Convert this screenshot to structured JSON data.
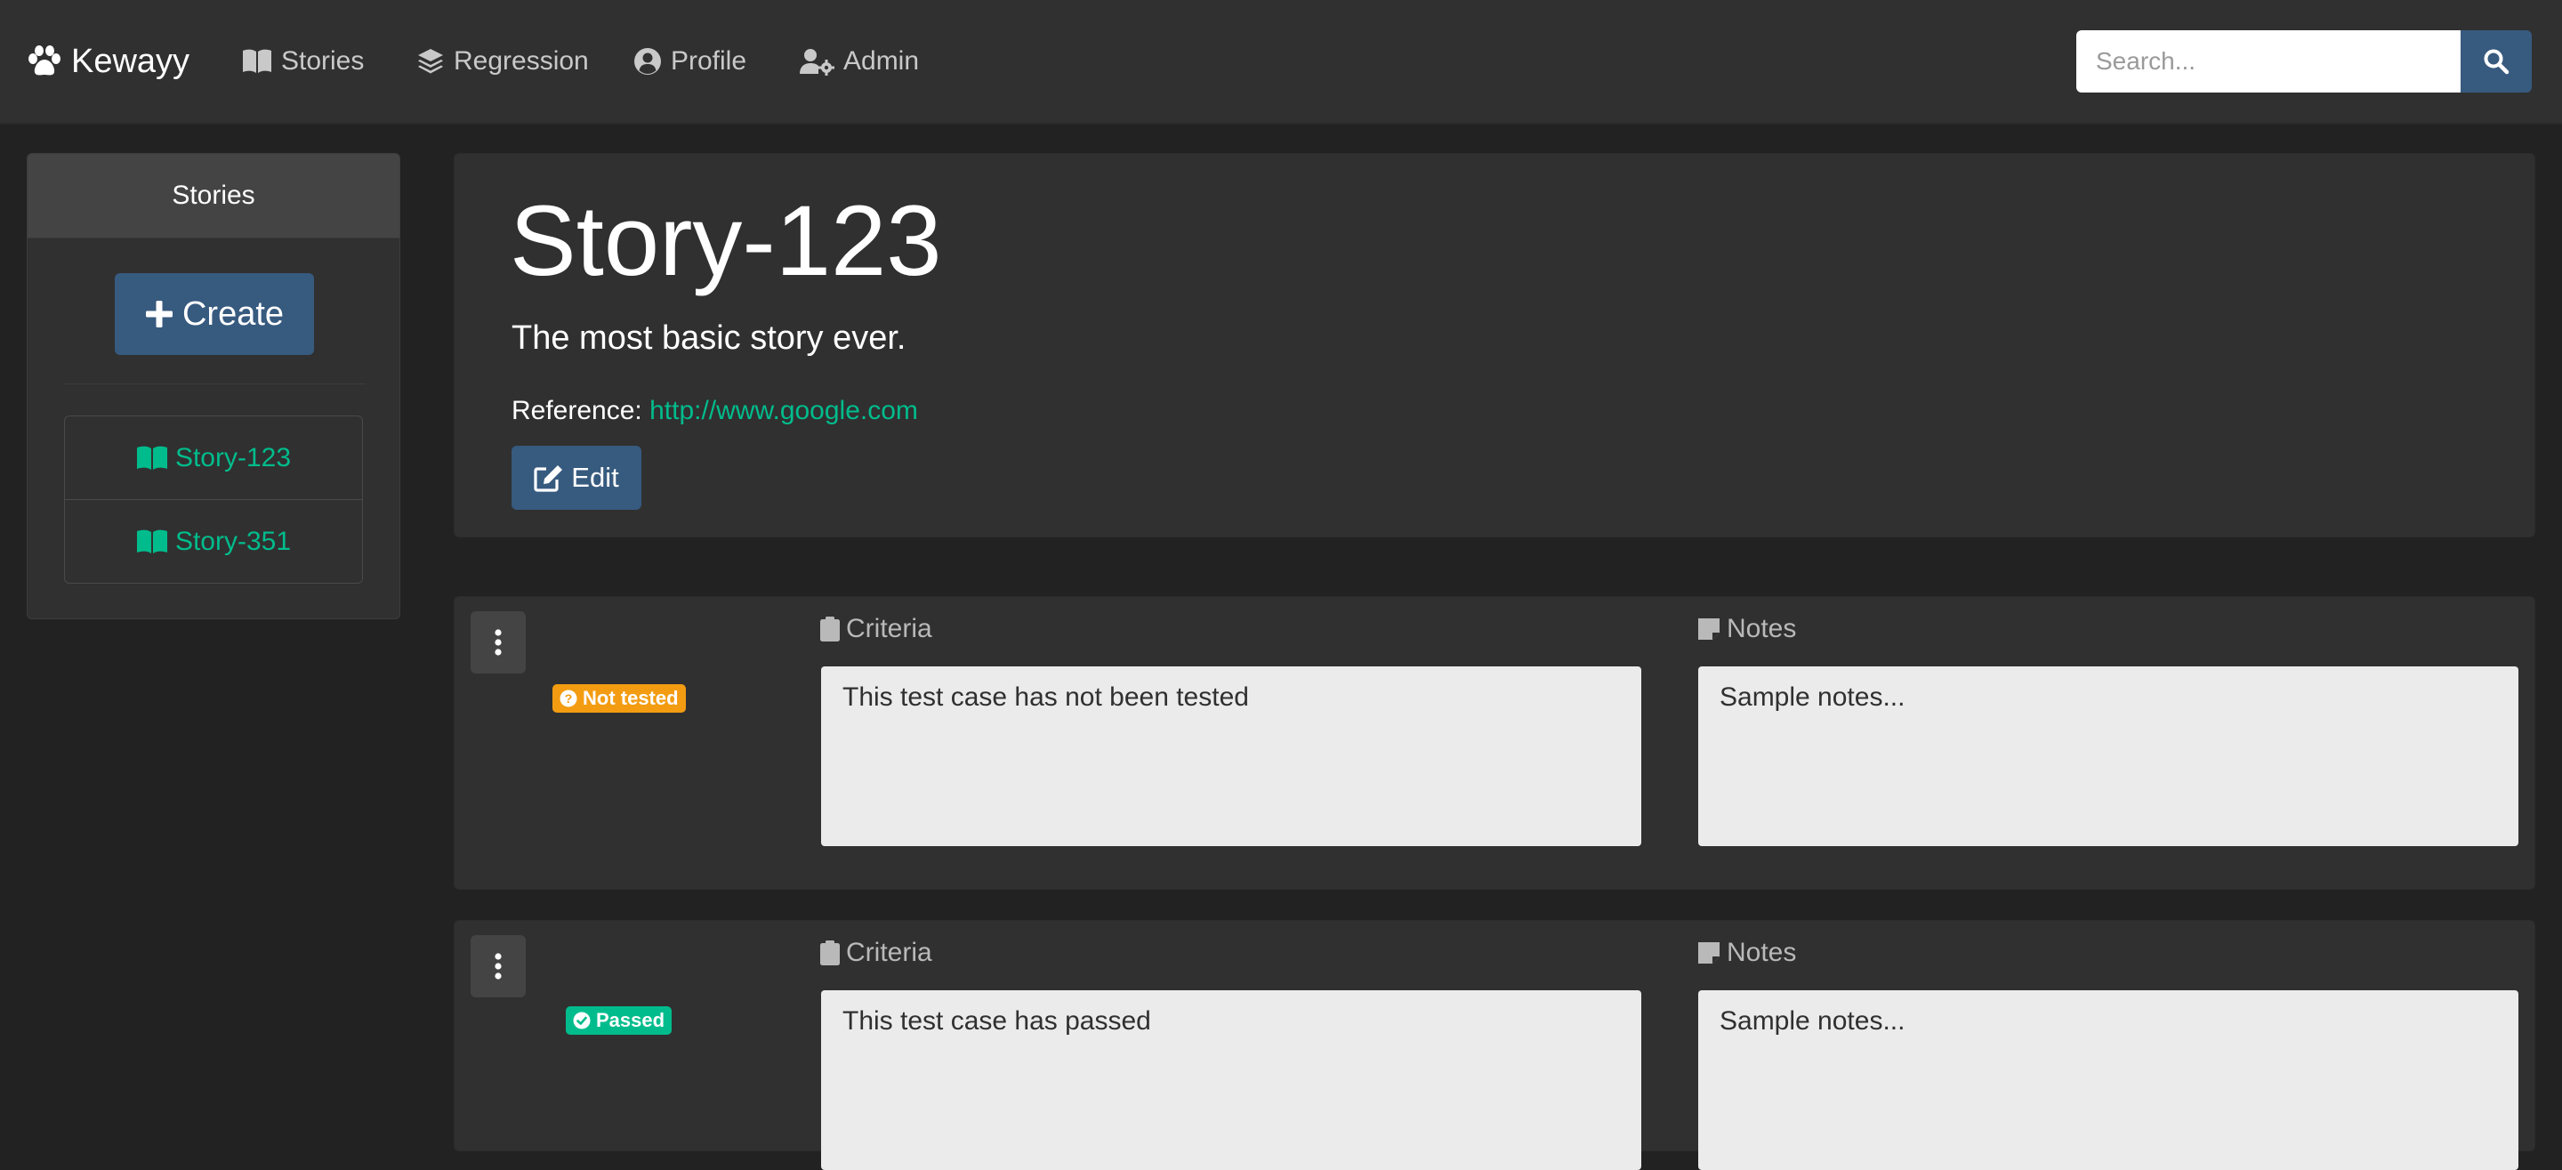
{
  "nav": {
    "brand": "Kewayy",
    "links": [
      {
        "label": "Stories",
        "icon": "book-icon"
      },
      {
        "label": "Regression",
        "icon": "layers-icon"
      },
      {
        "label": "Profile",
        "icon": "user-circle-icon"
      },
      {
        "label": "Admin",
        "icon": "user-cog-icon"
      }
    ],
    "search_placeholder": "Search..."
  },
  "sidebar": {
    "title": "Stories",
    "create_label": "Create",
    "stories": [
      "Story-123",
      "Story-351"
    ]
  },
  "story": {
    "title": "Story-123",
    "description": "The most basic story ever.",
    "reference_label": "Reference:",
    "reference_url": "http://www.google.com",
    "edit_label": "Edit"
  },
  "cases": [
    {
      "status": "Not tested",
      "status_color": "#f39c12",
      "criteria_label": "Criteria",
      "criteria_text": "This test case has not been tested",
      "notes_label": "Notes",
      "notes_text": "Sample notes..."
    },
    {
      "status": "Passed",
      "status_color": "#00bc8c",
      "criteria_label": "Criteria",
      "criteria_text": "This test case has passed",
      "notes_label": "Notes",
      "notes_text": "Sample notes..."
    }
  ],
  "colors": {
    "primary": "#375a7f",
    "success": "#00bc8c",
    "warning": "#f39c12",
    "background": "#222222",
    "panel": "#303030"
  }
}
